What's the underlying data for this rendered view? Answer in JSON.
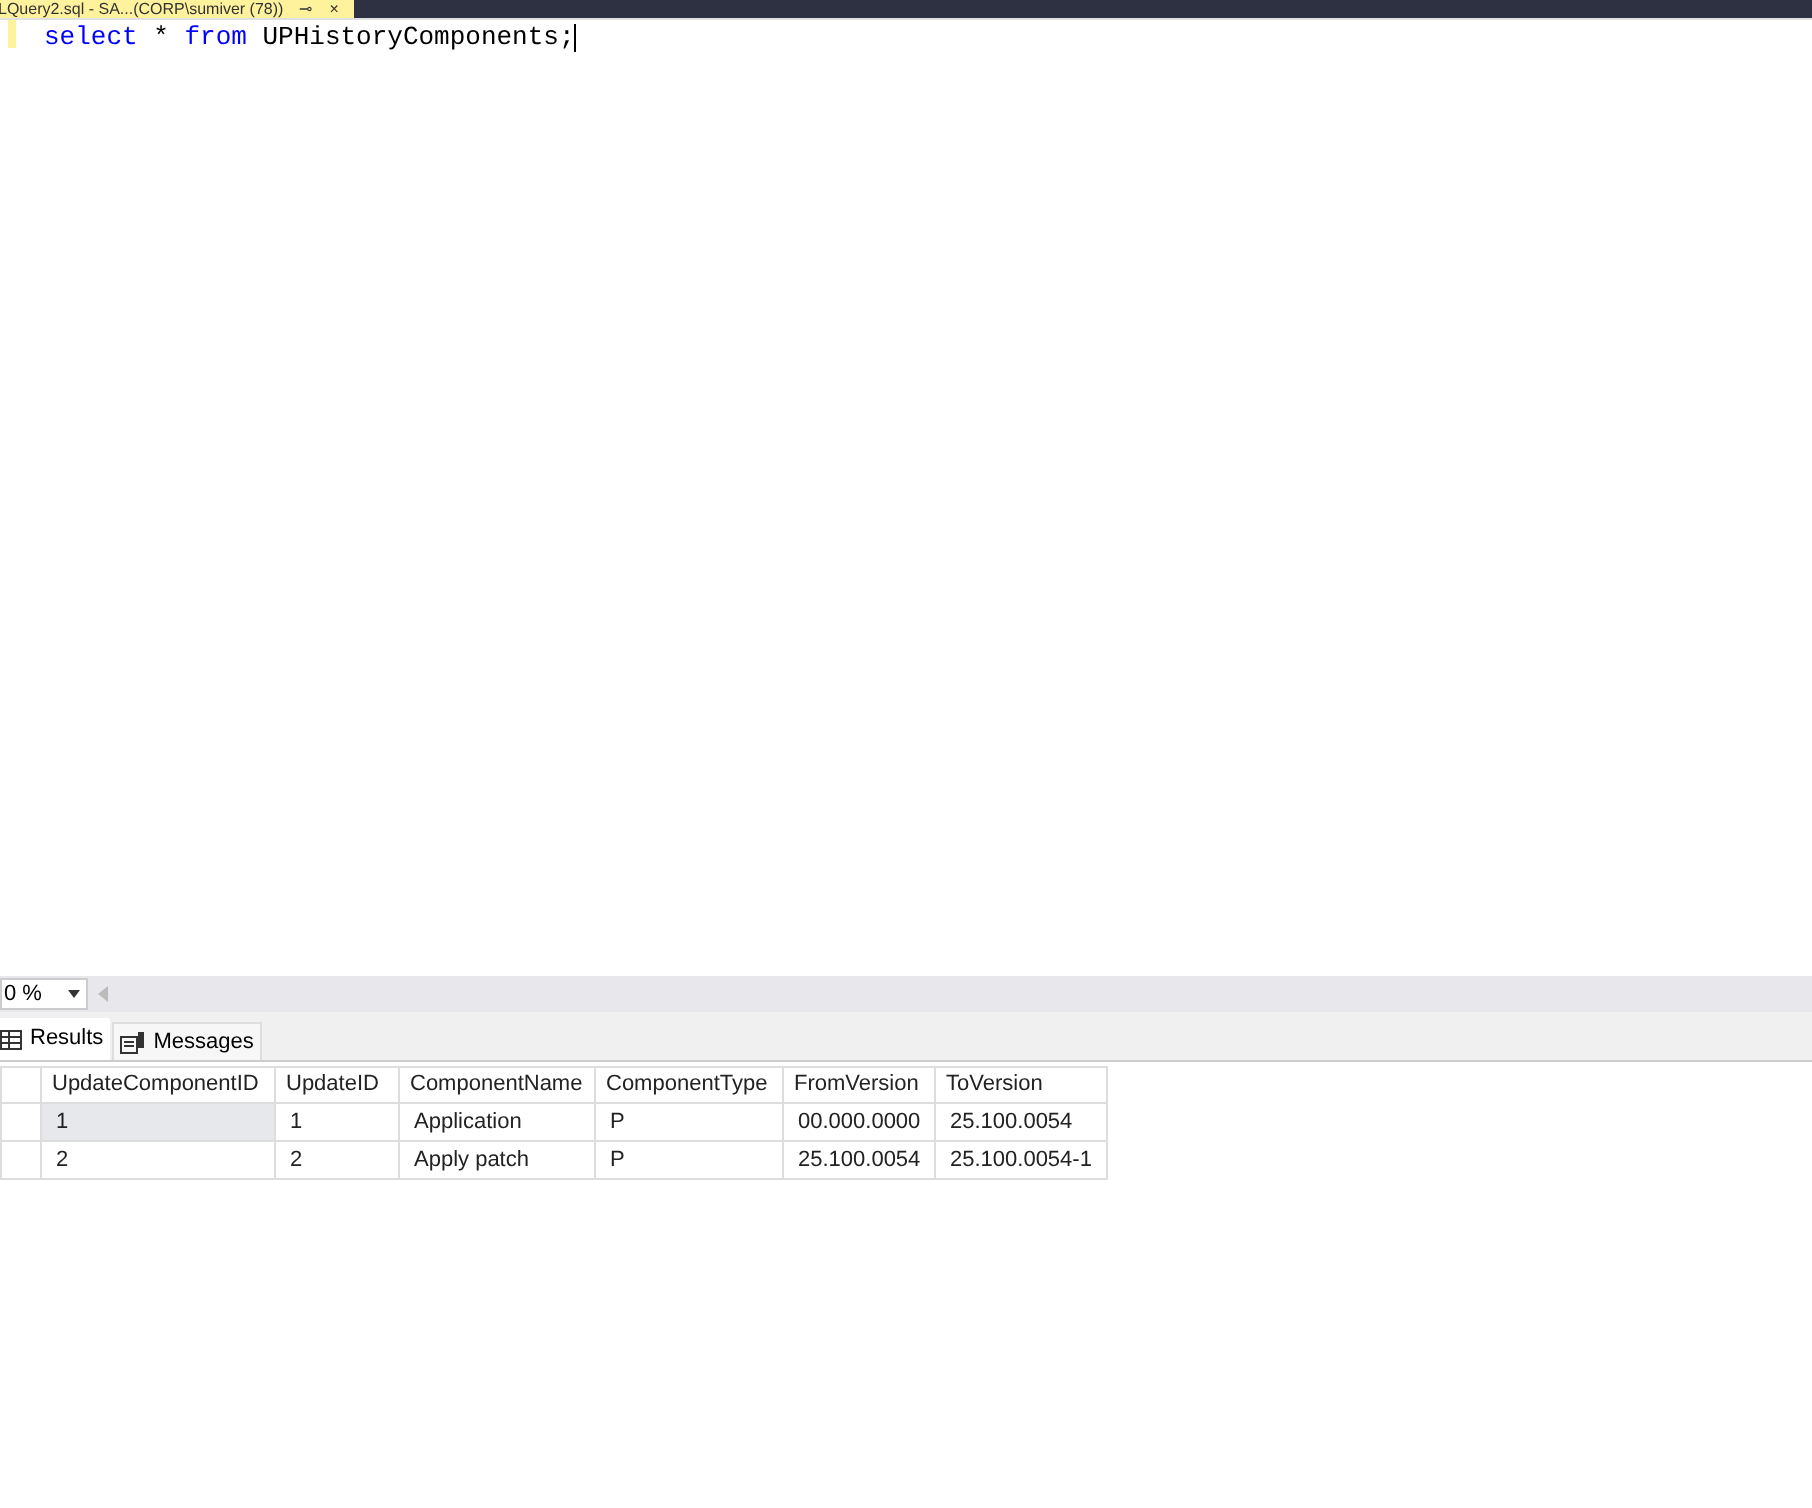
{
  "document_tab": {
    "title": "LQuery2.sql - SA...(CORP\\sumiver (78))",
    "pin": "⊸",
    "close": "×"
  },
  "editor": {
    "tokens": [
      {
        "kind": "keyword",
        "text": "select"
      },
      {
        "kind": "plain",
        "text": " * "
      },
      {
        "kind": "keyword",
        "text": "from"
      },
      {
        "kind": "plain",
        "text": " UPHistoryComponents;"
      }
    ]
  },
  "zoom": {
    "value": "0 %"
  },
  "result_tabs": [
    {
      "label": "Results",
      "selected": true
    },
    {
      "label": "Messages",
      "selected": false
    }
  ],
  "table": {
    "columns": [
      "UpdateComponentID",
      "UpdateID",
      "ComponentName",
      "ComponentType",
      "FromVersion",
      "ToVersion"
    ],
    "rows": [
      {
        "selected": true,
        "cells": [
          "1",
          "1",
          "Application",
          "P",
          "00.000.0000",
          "25.100.0054"
        ]
      },
      {
        "selected": false,
        "cells": [
          "2",
          "2",
          "Apply patch",
          "P",
          "25.100.0054",
          "25.100.0054-1"
        ]
      }
    ]
  }
}
